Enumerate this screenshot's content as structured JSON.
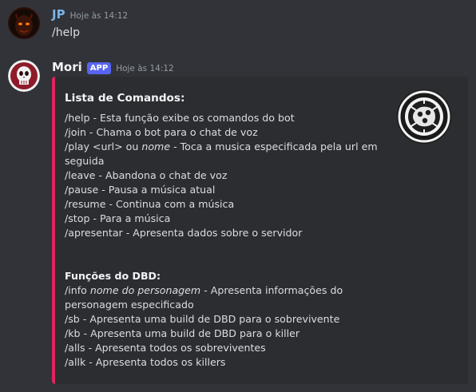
{
  "messages": [
    {
      "author": "JP",
      "timestamp": "Hoje às 14:12",
      "content": "/help"
    },
    {
      "author": "Mori",
      "badge": "APP",
      "timestamp": "Hoje às 14:12"
    }
  ],
  "embed": {
    "accent_color": "#e0245e",
    "thumbnail_icon": "mori-logo-icon",
    "title": "Lista de Comandos:",
    "commands": [
      {
        "pre": "/help - Esta função exibe os comandos do bot",
        "em": "",
        "post": ""
      },
      {
        "pre": "/join - Chama o bot para o chat de voz",
        "em": "",
        "post": ""
      },
      {
        "pre": "/play <url> ou ",
        "em": "nome",
        "post": " - Toca a musica especificada pela url em seguida"
      },
      {
        "pre": "/leave - Abandona o chat de voz",
        "em": "",
        "post": ""
      },
      {
        "pre": "/pause - Pausa a música atual",
        "em": "",
        "post": ""
      },
      {
        "pre": "/resume - Continua com a música",
        "em": "",
        "post": ""
      },
      {
        "pre": "/stop - Para a música",
        "em": "",
        "post": ""
      },
      {
        "pre": "/apresentar - Apresenta dados sobre o servidor",
        "em": "",
        "post": ""
      }
    ],
    "dbd_title": "Funções do DBD:",
    "dbd_commands": [
      {
        "pre": "/info ",
        "em": "nome do personagem",
        "post": " - Apresenta informações do personagem especificado"
      },
      {
        "pre": "/sb - Apresenta uma build de DBD para o sobrevivente",
        "em": "",
        "post": ""
      },
      {
        "pre": "/kb - Apresenta uma build de DBD para o killer",
        "em": "",
        "post": ""
      },
      {
        "pre": "/alls - Apresenta todos os sobreviventes",
        "em": "",
        "post": ""
      },
      {
        "pre": "/allk - Apresenta todos os killers",
        "em": "",
        "post": ""
      }
    ]
  },
  "colors": {
    "background": "#313338",
    "embed_background": "#2b2d31",
    "jp_name": "#78b3e8",
    "app_badge": "#5865f2"
  }
}
